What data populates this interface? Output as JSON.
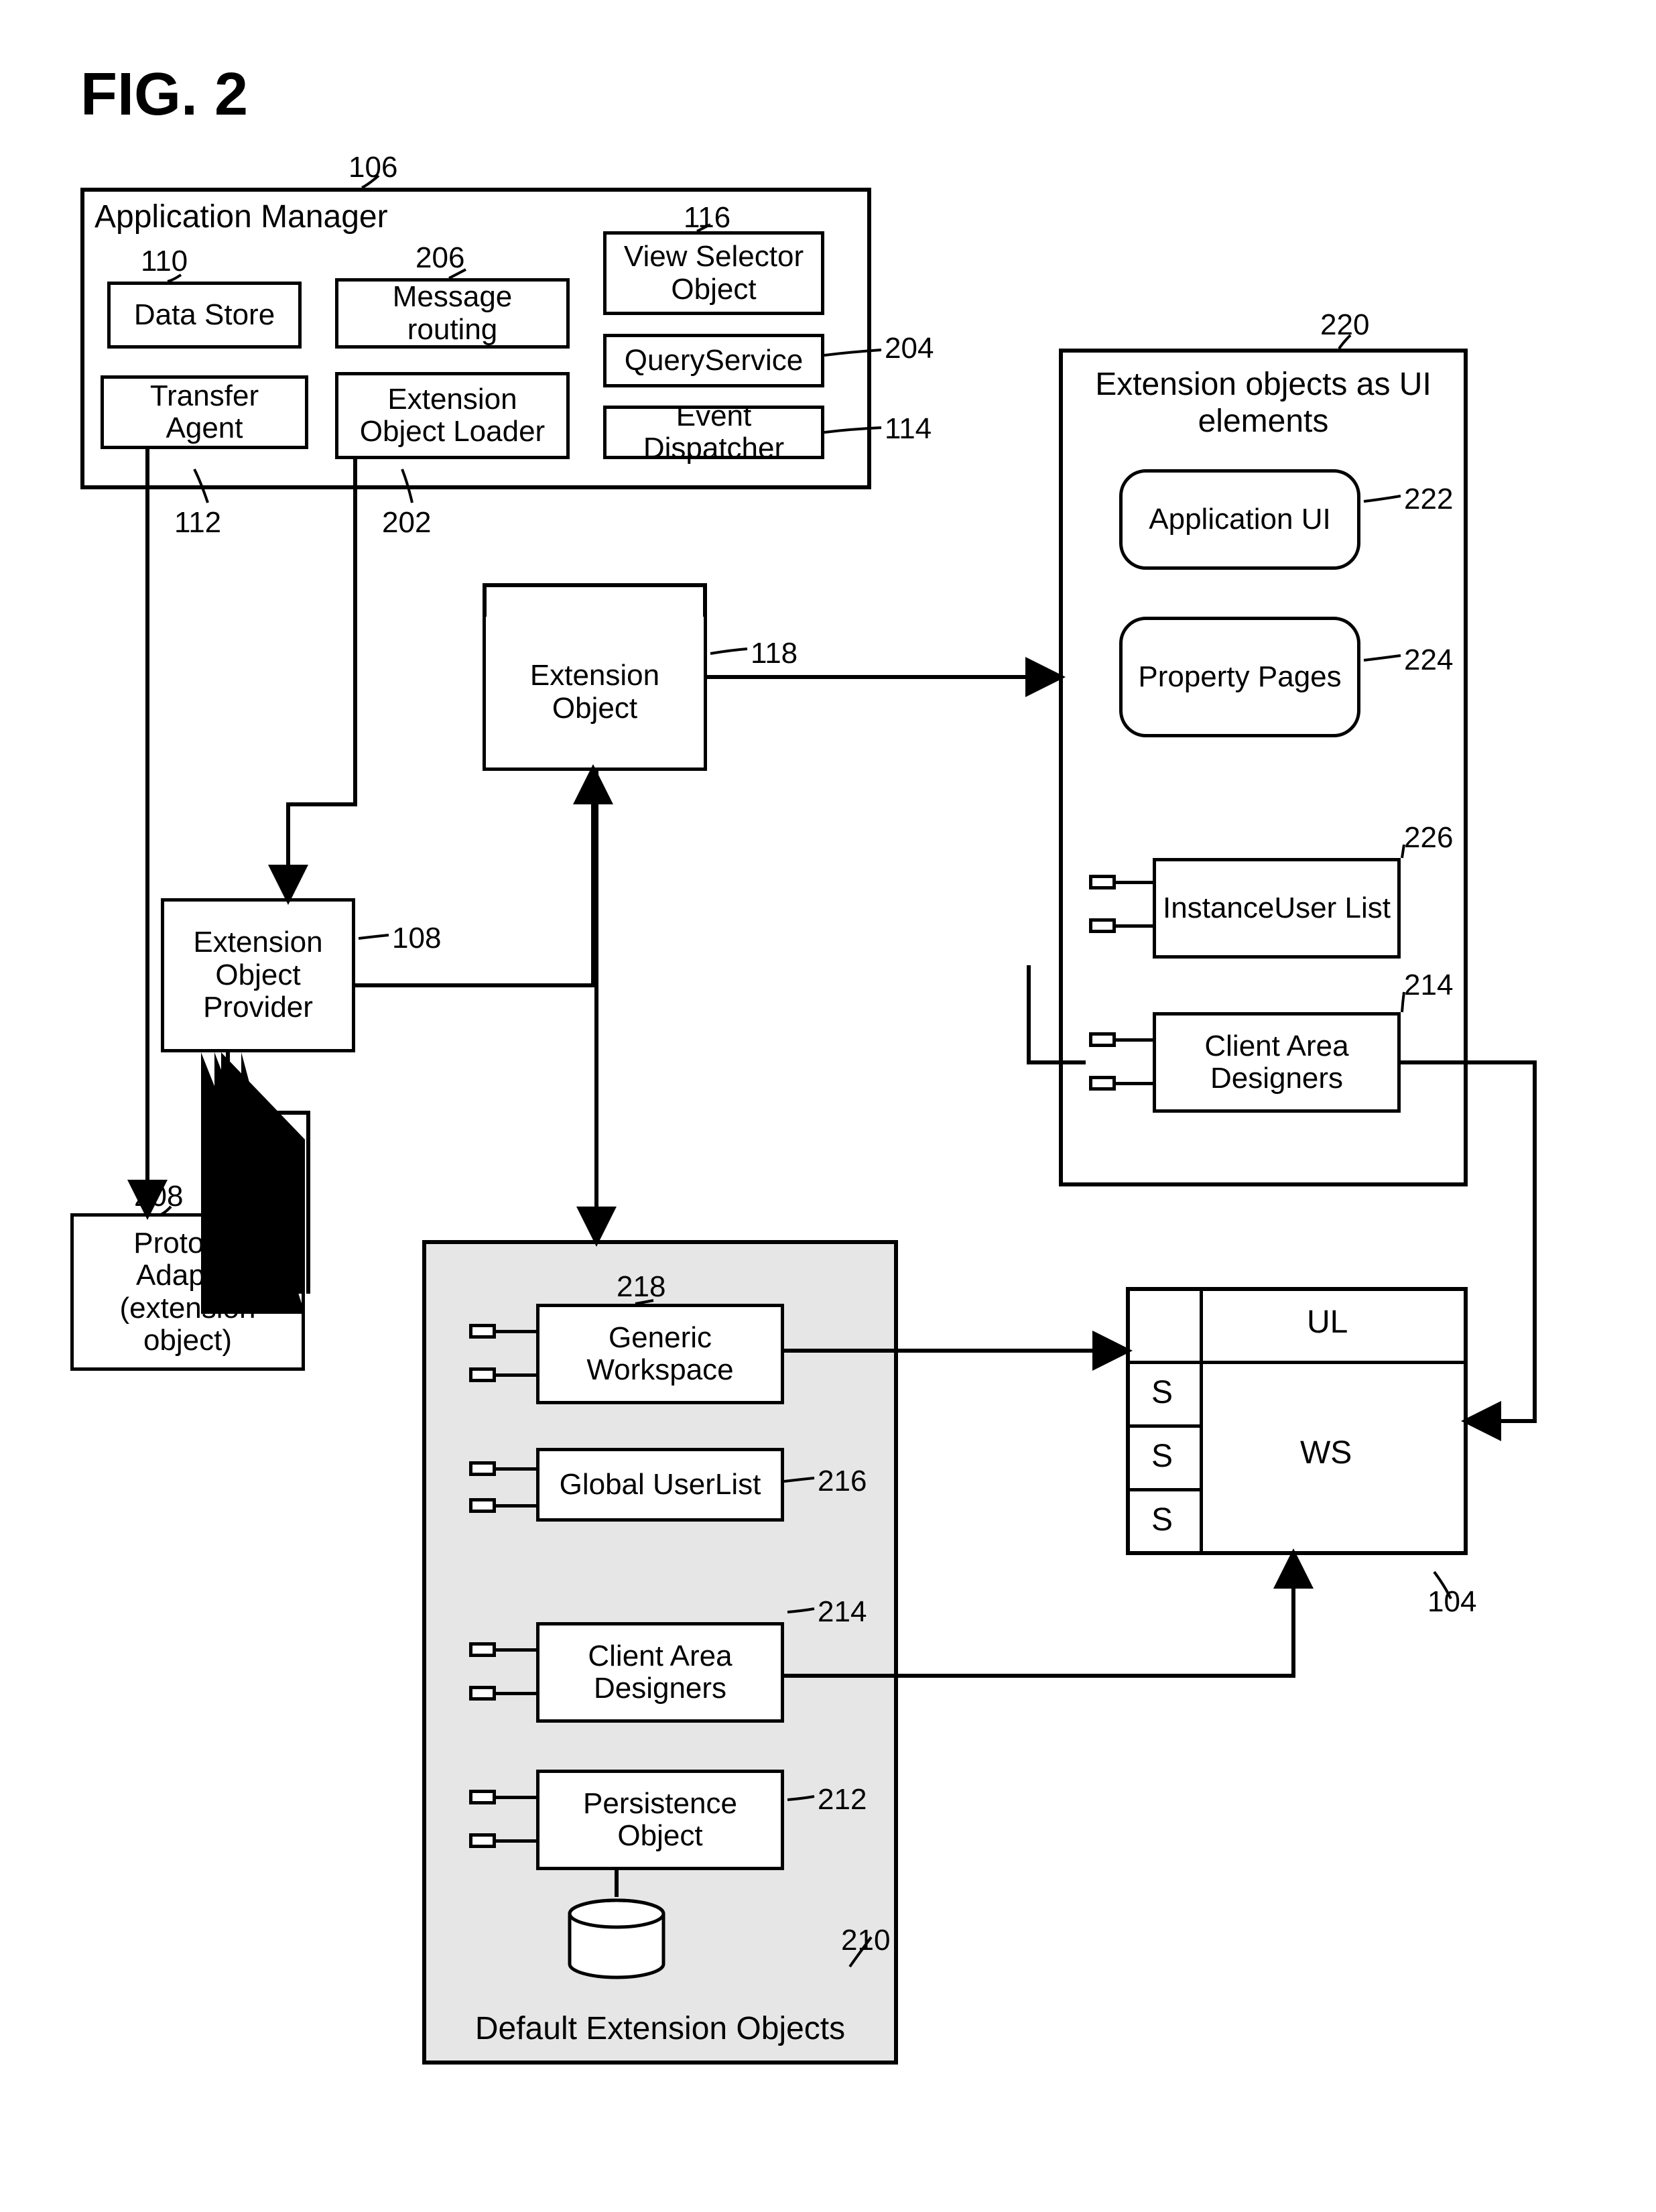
{
  "figure_title": "FIG. 2",
  "app_manager": {
    "title": "Application Manager",
    "num": "106",
    "data_store": {
      "label": "Data Store",
      "num": "110"
    },
    "transfer_agent": {
      "label": "Transfer Agent",
      "num": "112"
    },
    "message_routing": {
      "label": "Message routing",
      "num": "206"
    },
    "ext_loader": {
      "label": "Extension Object Loader",
      "num": "202"
    },
    "view_selector": {
      "label": "View Selector Object",
      "num": "116"
    },
    "query_service": {
      "label": "QueryService",
      "num": "204"
    },
    "event_dispatcher": {
      "label": "Event Dispatcher",
      "num": "114"
    }
  },
  "extension_object": {
    "label": "Extension Object",
    "num": "118"
  },
  "ext_provider": {
    "label": "Extension Object Provider",
    "num": "108"
  },
  "protocol_adapter": {
    "label": "Protocol Adapter (extension object)",
    "num": "208"
  },
  "ui_group": {
    "title": "Extension objects as UI elements",
    "num": "220",
    "app_ui": {
      "label": "Application UI",
      "num": "222"
    },
    "prop_pages": {
      "label": "Property Pages",
      "num": "224"
    },
    "instance_user_list": {
      "label": "InstanceUser List",
      "num": "226"
    },
    "client_area_designers": {
      "label": "Client Area Designers",
      "num": "214"
    }
  },
  "default_group": {
    "title": "Default Extension Objects",
    "num": "210",
    "generic_workspace": {
      "label": "Generic Workspace",
      "num": "218"
    },
    "global_user_list": {
      "label": "Global UserList",
      "num": "216"
    },
    "client_area_designers": {
      "label": "Client Area Designers",
      "num": "214"
    },
    "persistence_object": {
      "label": "Persistence Object",
      "num": "212"
    }
  },
  "main_window": {
    "num": "104",
    "ul": "UL",
    "ws": "WS",
    "s": "S"
  }
}
